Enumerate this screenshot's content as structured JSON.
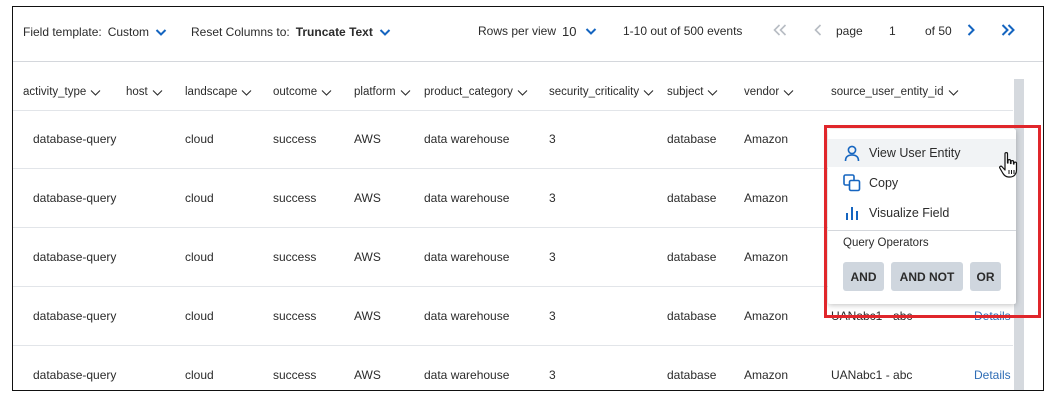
{
  "toolbar": {
    "field_template_label": "Field template:",
    "field_template_value": "Custom",
    "reset_columns_label": "Reset Columns to:",
    "reset_columns_value": "Truncate Text",
    "rows_per_view_label": "Rows per view",
    "rows_per_view_value": "10",
    "events_summary": "1-10 out of 500 events",
    "page_label": "page",
    "page_number": "1",
    "page_total": "of 50"
  },
  "columns": [
    "activity_type",
    "host",
    "landscape",
    "outcome",
    "platform",
    "product_category",
    "security_criticality",
    "subject",
    "vendor",
    "source_user_entity_id"
  ],
  "rows": [
    {
      "activity_type": "database-query",
      "landscape": "cloud",
      "outcome": "success",
      "platform": "AWS",
      "product_category": "data warehouse",
      "security_criticality": "3",
      "subject": "database",
      "vendor": "Amazon",
      "source_user_entity_id": "",
      "details": ""
    },
    {
      "activity_type": "database-query",
      "landscape": "cloud",
      "outcome": "success",
      "platform": "AWS",
      "product_category": "data warehouse",
      "security_criticality": "3",
      "subject": "database",
      "vendor": "Amazon",
      "source_user_entity_id": "",
      "details": ""
    },
    {
      "activity_type": "database-query",
      "landscape": "cloud",
      "outcome": "success",
      "platform": "AWS",
      "product_category": "data warehouse",
      "security_criticality": "3",
      "subject": "database",
      "vendor": "Amazon",
      "source_user_entity_id": "",
      "details": ""
    },
    {
      "activity_type": "database-query",
      "landscape": "cloud",
      "outcome": "success",
      "platform": "AWS",
      "product_category": "data warehouse",
      "security_criticality": "3",
      "subject": "database",
      "vendor": "Amazon",
      "source_user_entity_id": "UANabc1 - abc",
      "details": "Details"
    },
    {
      "activity_type": "database-query",
      "landscape": "cloud",
      "outcome": "success",
      "platform": "AWS",
      "product_category": "data warehouse",
      "security_criticality": "3",
      "subject": "database",
      "vendor": "Amazon",
      "source_user_entity_id": "UANabc1 - abc",
      "details": "Details"
    }
  ],
  "context_menu": {
    "items": [
      {
        "label": "View User Entity",
        "icon": "user-icon"
      },
      {
        "label": "Copy",
        "icon": "copy-icon"
      },
      {
        "label": "Visualize Field",
        "icon": "bar-chart-icon"
      }
    ],
    "query_operators_label": "Query Operators",
    "operators": [
      "AND",
      "AND NOT",
      "OR"
    ]
  },
  "colors": {
    "accent_blue": "#1565c0",
    "link_blue": "#2f6db5",
    "highlight_red": "#e0262b",
    "operator_button": "#cfd6de"
  }
}
